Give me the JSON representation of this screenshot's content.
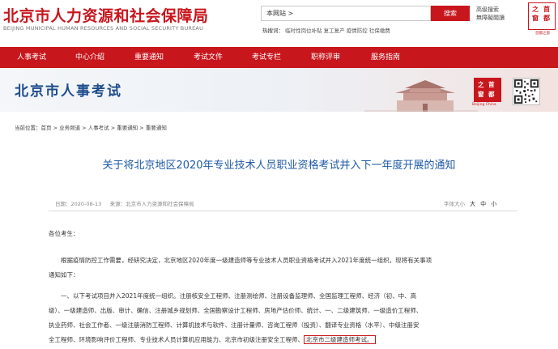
{
  "header": {
    "title_cn": "北京市人力资源和社会保障局",
    "title_en": "BEIJING MUNICIPAL HUMAN RESOURCES AND SOCIAL SECURITY BUREAU",
    "search_value": "本网站 >",
    "search_button": "搜索",
    "advanced_search_1": "高级搜索",
    "advanced_search_2": "無障礙閱讀",
    "hot_label": "热搜词：",
    "hot_words": "临时性岗位补贴  复工复产  疫情防控  社保缴费",
    "seal_chars": [
      "首",
      "都",
      "之",
      "窗"
    ],
    "seal_caption": "首都之窗"
  },
  "nav": {
    "items": [
      "人事考试",
      "中心介绍",
      "重要通知",
      "考试文件",
      "考试专栏",
      "职称评审",
      "服务指南"
    ]
  },
  "banner": {
    "title": "北京市人事考试",
    "seal_chars": [
      "首",
      "都",
      "之",
      "窗"
    ],
    "seal_caption": "Beijing China"
  },
  "breadcrumb": {
    "text": "当前位置：首页 > 业务频道 > 人事考试 > 重要通知 > 重要通知"
  },
  "article": {
    "title": "关于将北京地区2020年专业技术人员职业资格考试并入下一年度开展的通知",
    "date": "日期：2020-08-13",
    "source": "来源：北京市人力资源和社会保障局",
    "font_label": "字体大小",
    "font_large": "大",
    "font_medium": "中",
    "font_small": "小",
    "greeting": "各位考生：",
    "p1_line1": "根据疫情防控工作需要，经研究决定，北京地区2020年度一级建造师等专业技术人员职业资格考试并入2021年度统一组织。现将有关事项",
    "p1_line2": "通知如下：",
    "p2_line1": "一、以下考试项目并入2021年度统一组织。注册核安全工程师、注册测绘师、注册设备监理师、全国监理工程师、经济（初、中、高",
    "p2_line2": "级）、一级建造师、出版、审计、确信、注册城乡规划师、全国勘察设计工程师、房地产估价师、统计、一、二级建筑师、一级造价工程师、",
    "p2_line3": "执业药师、社会工作者、一级注册消防工程师、计算机技术与软件、注册计量师、咨询工程师（投资）、翻译专业资格（水平）、中级注册安",
    "p2_line4": "全工程师、环境影响评价工程师、专业技术人员计算机应用能力、北京市初级注册安全工程师、",
    "p2_highlight": "北京市二级建造师考试。"
  }
}
